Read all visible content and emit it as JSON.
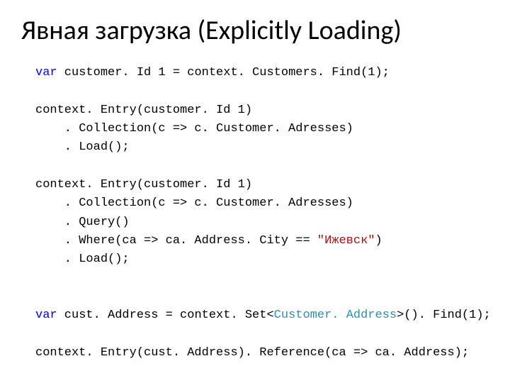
{
  "title": "Явная загрузка (Explicitly Loading)",
  "code": {
    "kw_var1": "var",
    "l1b": " customer. Id 1 = context. Customers. Find(1);",
    "l2": "context. Entry(customer. Id 1)",
    "l3": "    . Collection(c => c. Customer. Adresses)",
    "l4": "    . Load();",
    "l5": "context. Entry(customer. Id 1)",
    "l6": "    . Collection(c => c. Customer. Adresses)",
    "l7": "    . Query()",
    "l8a": "    . Where(ca => ca. Address. City == ",
    "l8_str": "\"Ижевск\"",
    "l8c": ")",
    "l9": "    . Load();",
    "kw_var2": "var",
    "l10a": " cust. Address = context. Set<",
    "l10_type": "Customer. Address",
    "l10c": ">(). Find(1);",
    "l11": "context. Entry(cust. Address). Reference(ca => ca. Address);"
  }
}
